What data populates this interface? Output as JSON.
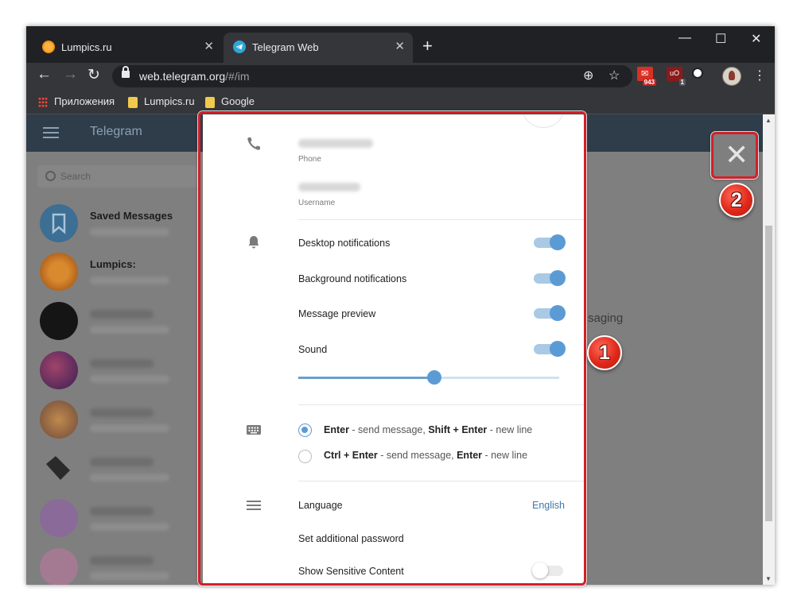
{
  "browser": {
    "tabs": [
      {
        "title": "Lumpics.ru",
        "favicon": "orange-slice-icon",
        "active": false
      },
      {
        "title": "Telegram Web",
        "favicon": "telegram-plane-icon",
        "active": true
      }
    ],
    "new_tab": "+",
    "window_controls": {
      "minimize": "—",
      "maximize": "☐",
      "close": "✕"
    },
    "url_host": "web.telegram.org",
    "url_path": "/#/im",
    "extensions": [
      {
        "name": "mail-extension-icon",
        "badge": "943",
        "color": "#d93025"
      },
      {
        "name": "ublock-icon",
        "badge": "1",
        "color": "#8b1a1a"
      },
      {
        "name": "eye-extension-icon",
        "badge": ""
      }
    ],
    "bookmarks": [
      {
        "label": "Приложения",
        "icon": "apps-grid-icon"
      },
      {
        "label": "Lumpics.ru",
        "icon": "folder-icon"
      },
      {
        "label": "Google",
        "icon": "folder-icon"
      }
    ]
  },
  "telegram": {
    "header_title": "Telegram",
    "search_placeholder": "Search",
    "chats": [
      {
        "name": "Saved Messages",
        "avatar_color": "#3d6e93"
      },
      {
        "name": "Lumpics:",
        "avatar_color": "#c46c17"
      },
      {
        "name": "",
        "avatar_color": "#111111"
      },
      {
        "name": "",
        "avatar_color": "#5a2f63"
      },
      {
        "name": "",
        "avatar_color": "#8a5a3c"
      },
      {
        "name": "",
        "avatar_color": "#2a2a2a"
      },
      {
        "name": "",
        "avatar_color": "#7c5c8c"
      },
      {
        "name": "",
        "avatar_color": "#9a6f88"
      }
    ],
    "background_text": "saging"
  },
  "settings": {
    "phone_label": "Phone",
    "username_label": "Username",
    "desktop_notifications": {
      "label": "Desktop notifications",
      "enabled": true
    },
    "background_notifications": {
      "label": "Background notifications",
      "enabled": true
    },
    "message_preview": {
      "label": "Message preview",
      "enabled": true
    },
    "sound": {
      "label": "Sound",
      "enabled": true,
      "volume_fraction": 0.52
    },
    "send_modes": [
      {
        "key": "Enter",
        "mid": " - send message, ",
        "key2": "Shift + Enter",
        "tail": " - new line",
        "selected": true
      },
      {
        "key": "Ctrl + Enter",
        "mid": " - send message, ",
        "key2": "Enter",
        "tail": " - new line",
        "selected": false
      }
    ],
    "language_label": "Language",
    "language_value": "English",
    "password_label": "Set additional password",
    "sensitive_label": "Show Sensitive Content",
    "sensitive_enabled": false
  },
  "annotations": {
    "badge1": "1",
    "badge2": "2",
    "close_symbol": "✕"
  },
  "colors": {
    "accent": "#5b9bd5",
    "highlight": "#d0202a",
    "header": "#2f3d4a"
  }
}
